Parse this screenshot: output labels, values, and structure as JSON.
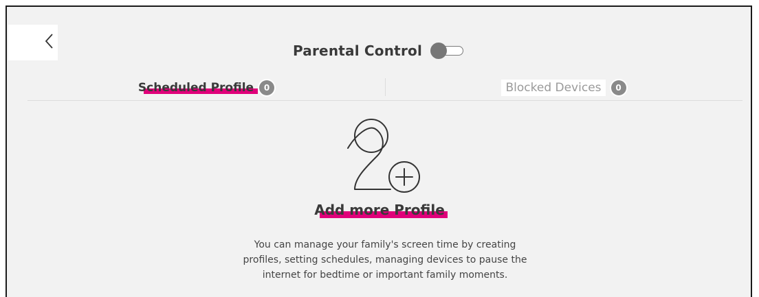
{
  "header": {
    "title": "Parental Control",
    "toggle_state": "off"
  },
  "tabs": [
    {
      "label": "Scheduled Profile",
      "count": "0",
      "active": true
    },
    {
      "label": "Blocked Devices",
      "count": "0",
      "active": false
    }
  ],
  "empty_state": {
    "icon": "add-profile-icon",
    "title": "Add more Profile",
    "description_lines": [
      "You can manage your family's screen time by creating",
      "profiles, setting schedules, managing devices to pause the",
      "internet for bedtime or important family moments."
    ]
  },
  "colors": {
    "highlight": "#e0007a",
    "badge": "#8a8a8a",
    "background": "#f2f2f2"
  }
}
